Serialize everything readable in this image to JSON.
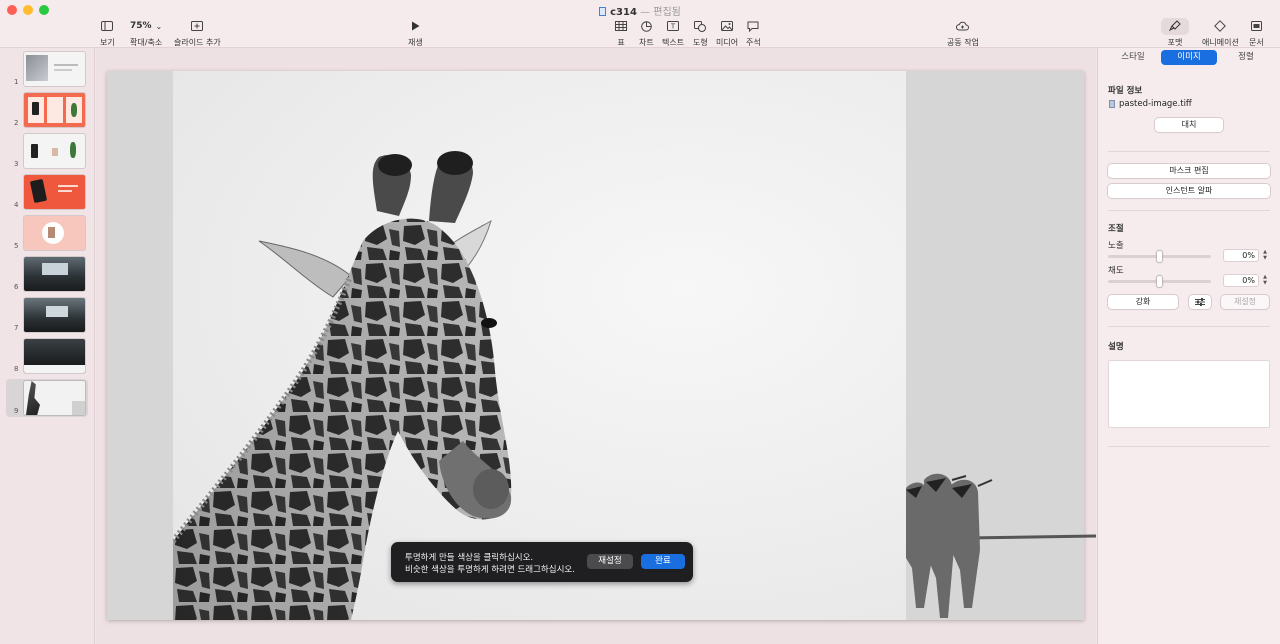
{
  "window": {
    "title": "c314",
    "title_separator": "—",
    "status": "편집됨"
  },
  "toolbar": {
    "view": "보기",
    "zoom_value": "75%",
    "zoom_label": "확대/축소",
    "add_slide": "슬라이드 추가",
    "play": "재생",
    "table": "표",
    "chart": "차트",
    "text": "텍스트",
    "shape": "도형",
    "media": "미디어",
    "comment": "주석",
    "collaborate": "공동 작업",
    "format": "포맷",
    "animate": "애니메이션",
    "document": "문서"
  },
  "navigator": {
    "slides": [
      {
        "num": "1"
      },
      {
        "num": "2"
      },
      {
        "num": "3"
      },
      {
        "num": "4"
      },
      {
        "num": "5"
      },
      {
        "num": "6"
      },
      {
        "num": "7"
      },
      {
        "num": "8"
      },
      {
        "num": "9"
      }
    ],
    "selected": "9"
  },
  "alpha_overlay": {
    "line1": "투명하게 만들 색상을 클릭하십시오.",
    "line2": "비슷한 색상을 투명하게 하려면 드래그하십시오.",
    "reset": "재설정",
    "done": "완료"
  },
  "inspector": {
    "tabs": {
      "style": "스타일",
      "image": "이미지",
      "arrange": "정렬"
    },
    "active_tab": "이미지",
    "file_info": {
      "title": "파일 정보",
      "filename": "pasted-image.tiff",
      "replace": "대치"
    },
    "edit_mask": "마스크 편집",
    "instant_alpha": "인스턴트 알파",
    "adjust": {
      "title": "조절",
      "exposure_label": "노출",
      "exposure_value": "0%",
      "saturation_label": "채도",
      "saturation_value": "0%",
      "enhance": "강화",
      "reset": "재설정"
    },
    "description": {
      "title": "설명",
      "value": ""
    }
  },
  "colors": {
    "accent": "#1a6fe0",
    "window_bg": "#f3e6e8",
    "overlay_bg": "#1f1f21"
  }
}
